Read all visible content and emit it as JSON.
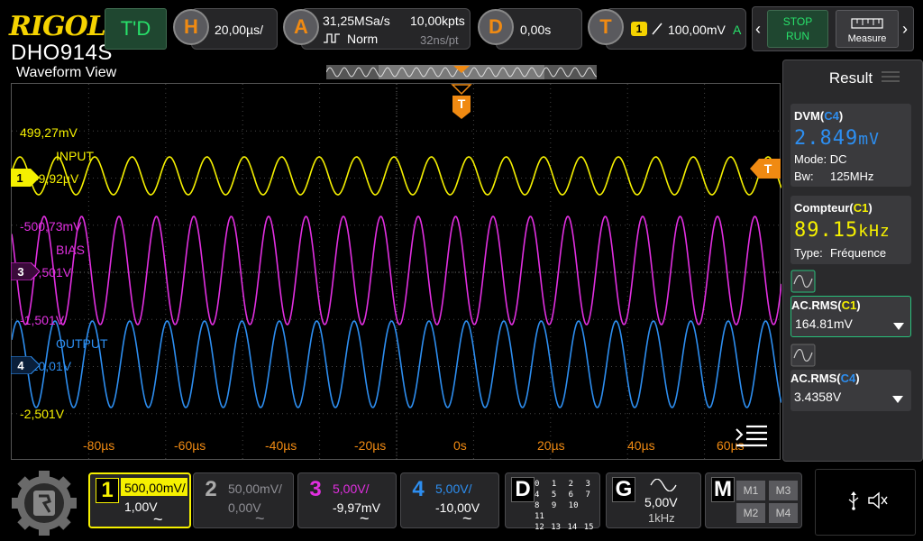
{
  "header": {
    "brand": "RIGOL",
    "model": "DHO914S",
    "td_label": "T'D",
    "horizontal": {
      "key": "H",
      "timebase": "20,00µs/"
    },
    "acquire": {
      "key": "A",
      "sample_rate": "31,25MSa/s",
      "mode": "Norm",
      "memory": "10,00kpts",
      "resolution": "32ns/pt"
    },
    "delay": {
      "key": "D",
      "value": "0,00s"
    },
    "trigger": {
      "key": "T",
      "source": "1",
      "level": "100,00mV",
      "status": "A"
    },
    "stop_label": "STOP",
    "run_label": "RUN",
    "measure_label": "Measure"
  },
  "waveform": {
    "title": "Waveform View",
    "trigger_mark": "T",
    "channels": [
      {
        "id": "1",
        "name": "INPUT",
        "scale_top": "499,27mV",
        "offset": "-9,92µV",
        "color": "#f5f000"
      },
      {
        "id": "3",
        "name": "BIAS",
        "scale_top": "-500,73mV",
        "offset": "-9,501V",
        "color": "#e12fe0"
      },
      {
        "id": "4",
        "name": "OUTPUT",
        "scale_top": "-1,501V",
        "offset": "-2,501V",
        "offset_mid": "-10,01V",
        "color": "#2d8ef0"
      }
    ],
    "x_ticks": [
      "-80µs",
      "-60µs",
      "-40µs",
      "-20µs",
      "0s",
      "20µs",
      "40µs",
      "60µs",
      "80µs"
    ]
  },
  "result": {
    "title": "Result",
    "dvm": {
      "label": "DVM(",
      "src": "C4",
      "close": ")",
      "value": "2.849",
      "unit": "mV",
      "mode": "Mode: DC",
      "bw_label": "Bw:",
      "bw_value": "125MHz"
    },
    "counter": {
      "label": "Compteur(",
      "src": "C1",
      "close": ")",
      "value": "89.15",
      "unit": "kHz",
      "type_label": "Type:",
      "type_value": "Fréquence"
    },
    "acrms1": {
      "label": "AC.RMS(",
      "src": "C1",
      "close": ")",
      "value": "164.81mV"
    },
    "acrms4": {
      "label": "AC.RMS(",
      "src": "C4",
      "close": ")",
      "value": "3.4358V"
    }
  },
  "footer": {
    "ch1": {
      "num": "1",
      "scale": "500,00mV/",
      "offset": "1,00V",
      "coupling": "~"
    },
    "ch2": {
      "num": "2",
      "scale": "50,00mV/",
      "offset": "0,00V",
      "coupling": "~"
    },
    "ch3": {
      "num": "3",
      "scale": "5,00V/",
      "offset": "-9,97mV",
      "coupling": "~"
    },
    "ch4": {
      "num": "4",
      "scale": "5,00V/",
      "offset": "-10,00V",
      "coupling": "~"
    },
    "digital": {
      "key": "D",
      "rows": [
        "0 1 2 3",
        "4 5 6 7",
        "8 9 10 11",
        "12 13 14 15"
      ]
    },
    "gen": {
      "key": "G",
      "amplitude": "5,00V",
      "freq": "1kHz"
    },
    "math": {
      "key": "M",
      "items": [
        "M1",
        "M3",
        "M2",
        "M4"
      ]
    }
  }
}
